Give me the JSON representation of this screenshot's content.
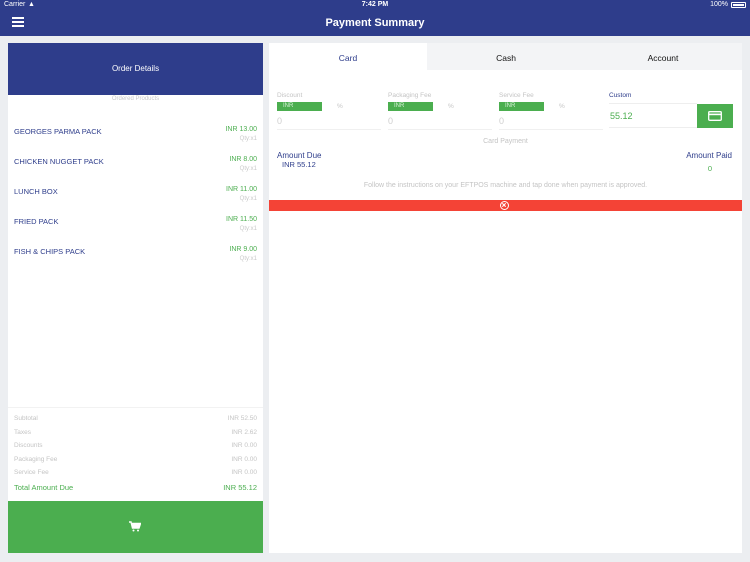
{
  "status_bar": {
    "carrier": "Carrier",
    "time": "7:42 PM",
    "battery": "100%"
  },
  "nav": {
    "title": "Payment Summary"
  },
  "order": {
    "header": "Order Details",
    "subheader": "Ordered Products",
    "items": [
      {
        "name": "GEORGES PARMA PACK",
        "price": "INR 13.00",
        "qty": "Qty:x1"
      },
      {
        "name": "CHICKEN NUGGET PACK",
        "price": "INR 8.00",
        "qty": "Qty:x1"
      },
      {
        "name": "LUNCH BOX",
        "price": "INR 11.00",
        "qty": "Qty:x1"
      },
      {
        "name": "FRIED PACK",
        "price": "INR 11.50",
        "qty": "Qty:x1"
      },
      {
        "name": "FISH & CHIPS PACK",
        "price": "INR 9.00",
        "qty": "Qty:x1"
      }
    ],
    "summary": [
      {
        "label": "Subtotal",
        "value": "INR 52.50"
      },
      {
        "label": "Taxes",
        "value": "INR 2.62"
      },
      {
        "label": "Discounts",
        "value": "INR 0.00"
      },
      {
        "label": "Packaging Fee",
        "value": "INR 0.00"
      },
      {
        "label": "Service Fee",
        "value": "INR 0.00"
      }
    ],
    "total": {
      "label": "Total Amount Due",
      "value": "INR 55.12"
    }
  },
  "payment": {
    "tabs": [
      "Card",
      "Cash",
      "Account"
    ],
    "fees": [
      {
        "label": "Discount",
        "currency": "INR",
        "pct": "%",
        "value": "0"
      },
      {
        "label": "Packaging Fee",
        "currency": "INR",
        "pct": "%",
        "value": "0"
      },
      {
        "label": "Service Fee",
        "currency": "INR",
        "pct": "%",
        "value": "0"
      }
    ],
    "custom": {
      "label": "Custom",
      "value": "55.12"
    },
    "card_payment_label": "Card Payment",
    "amount_due": {
      "label": "Amount Due",
      "value": "INR 55.12"
    },
    "amount_paid": {
      "label": "Amount Paid",
      "value": "0"
    },
    "instructions": "Follow the instructions on your EFTPOS machine and tap done when payment is approved."
  },
  "colors": {
    "primary": "#2e3d8b",
    "accent": "#4bae4f",
    "error": "#f44336"
  },
  "icons": {
    "menu": "hamburger-icon",
    "cart": "cart-icon",
    "card": "credit-card-icon",
    "close": "close-circle-icon",
    "wifi": "wifi-icon"
  }
}
